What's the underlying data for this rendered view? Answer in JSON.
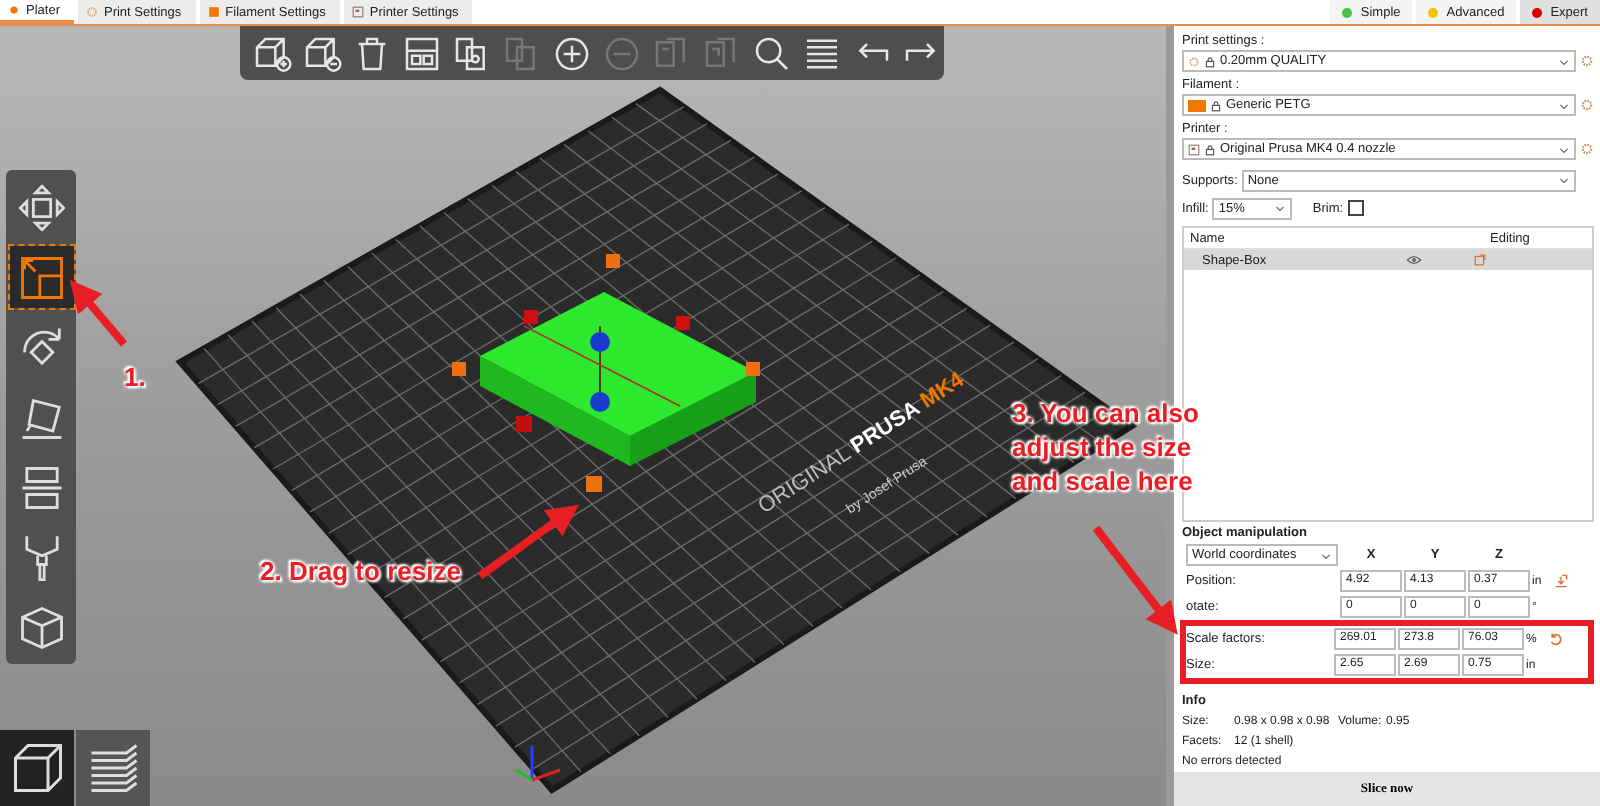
{
  "tabs": [
    {
      "label": "Plater",
      "kind": "plater",
      "selected": true
    },
    {
      "label": "Print Settings",
      "kind": "print",
      "selected": false
    },
    {
      "label": "Filament Settings",
      "kind": "filament",
      "selected": false
    },
    {
      "label": "Printer Settings",
      "kind": "printer",
      "selected": false
    }
  ],
  "modes": [
    {
      "label": "Simple",
      "color": "#4cc04c",
      "selected": false
    },
    {
      "label": "Advanced",
      "color": "#f2c500",
      "selected": false
    },
    {
      "label": "Expert",
      "color": "#d40000",
      "selected": true
    }
  ],
  "toolbar": [
    {
      "kind": "add",
      "disabled": false
    },
    {
      "kind": "delete",
      "disabled": false
    },
    {
      "kind": "delete-all",
      "disabled": false
    },
    {
      "kind": "arrange",
      "disabled": false
    },
    {
      "kind": "copy",
      "disabled": false
    },
    {
      "kind": "paste",
      "disabled": true
    },
    {
      "kind": "add-instance",
      "disabled": false
    },
    {
      "kind": "remove-instance",
      "disabled": true
    },
    {
      "kind": "split-objects",
      "disabled": true
    },
    {
      "kind": "split-parts",
      "disabled": true
    },
    {
      "kind": "search",
      "disabled": false
    },
    {
      "kind": "layers",
      "disabled": false
    },
    {
      "kind": "undo",
      "disabled": false
    },
    {
      "kind": "redo",
      "disabled": false
    }
  ],
  "gizmos": [
    {
      "kind": "move",
      "selected": false
    },
    {
      "kind": "scale",
      "selected": true
    },
    {
      "kind": "rotate",
      "selected": false
    },
    {
      "kind": "place",
      "selected": false
    },
    {
      "kind": "cut",
      "selected": false
    },
    {
      "kind": "paint",
      "selected": false
    },
    {
      "kind": "cube",
      "selected": false
    }
  ],
  "views": [
    {
      "kind": "editor",
      "selected": true
    },
    {
      "kind": "preview",
      "selected": false
    }
  ],
  "bed_label": {
    "brand": "ORIGINAL",
    "name": "PRUSA",
    "model": "MK4",
    "maker": "by Josef Prusa"
  },
  "annotations": [
    {
      "text": "1."
    },
    {
      "text": "2. Drag to resize"
    },
    {
      "text": "3. You can also adjust the size and scale here"
    }
  ],
  "presets": [
    {
      "label": "Print settings :",
      "value": "0.20mm QUALITY",
      "kind": "print"
    },
    {
      "label": "Filament :",
      "value": "Generic PETG",
      "kind": "filament",
      "color": "#f07800"
    },
    {
      "label": "Printer :",
      "value": "Original Prusa MK4 0.4 nozzle",
      "kind": "printer"
    }
  ],
  "supports": {
    "label": "Supports:",
    "value": "None"
  },
  "infill": {
    "label": "Infill:",
    "value": "15%"
  },
  "brim": {
    "label": "Brim:",
    "checked": false
  },
  "object_list": {
    "columns": [
      "Name",
      "Editing"
    ],
    "rows": [
      {
        "name": "Shape-Box",
        "selected": true
      }
    ]
  },
  "manipulation": {
    "title": "Object manipulation",
    "coordinates": "World coordinates",
    "axes": [
      "X",
      "Y",
      "Z"
    ],
    "rows": [
      {
        "kind": "position",
        "label": "Position:",
        "values": [
          "4.92",
          "4.13",
          "0.37"
        ],
        "unit": "in"
      },
      {
        "kind": "rotation",
        "label": "otate:",
        "values": [
          "0",
          "0",
          "0"
        ],
        "unit": "°"
      },
      {
        "kind": "scale",
        "label": "Scale factors:",
        "values": [
          "269.01",
          "273.8",
          "76.03"
        ],
        "unit": "%",
        "highlighted": true
      },
      {
        "kind": "size",
        "label": "Size:",
        "values": [
          "2.65",
          "2.69",
          "0.75"
        ],
        "unit": "in",
        "highlighted": true
      }
    ]
  },
  "info": {
    "title": "Info",
    "size_label": "Size:",
    "size": "0.98 x 0.98 x 0.98",
    "volume_label": "Volume:",
    "volume": "0.95",
    "facets_label": "Facets:",
    "facets": "12 (1 shell)",
    "status": "No errors detected"
  },
  "slice_button": "Slice now"
}
